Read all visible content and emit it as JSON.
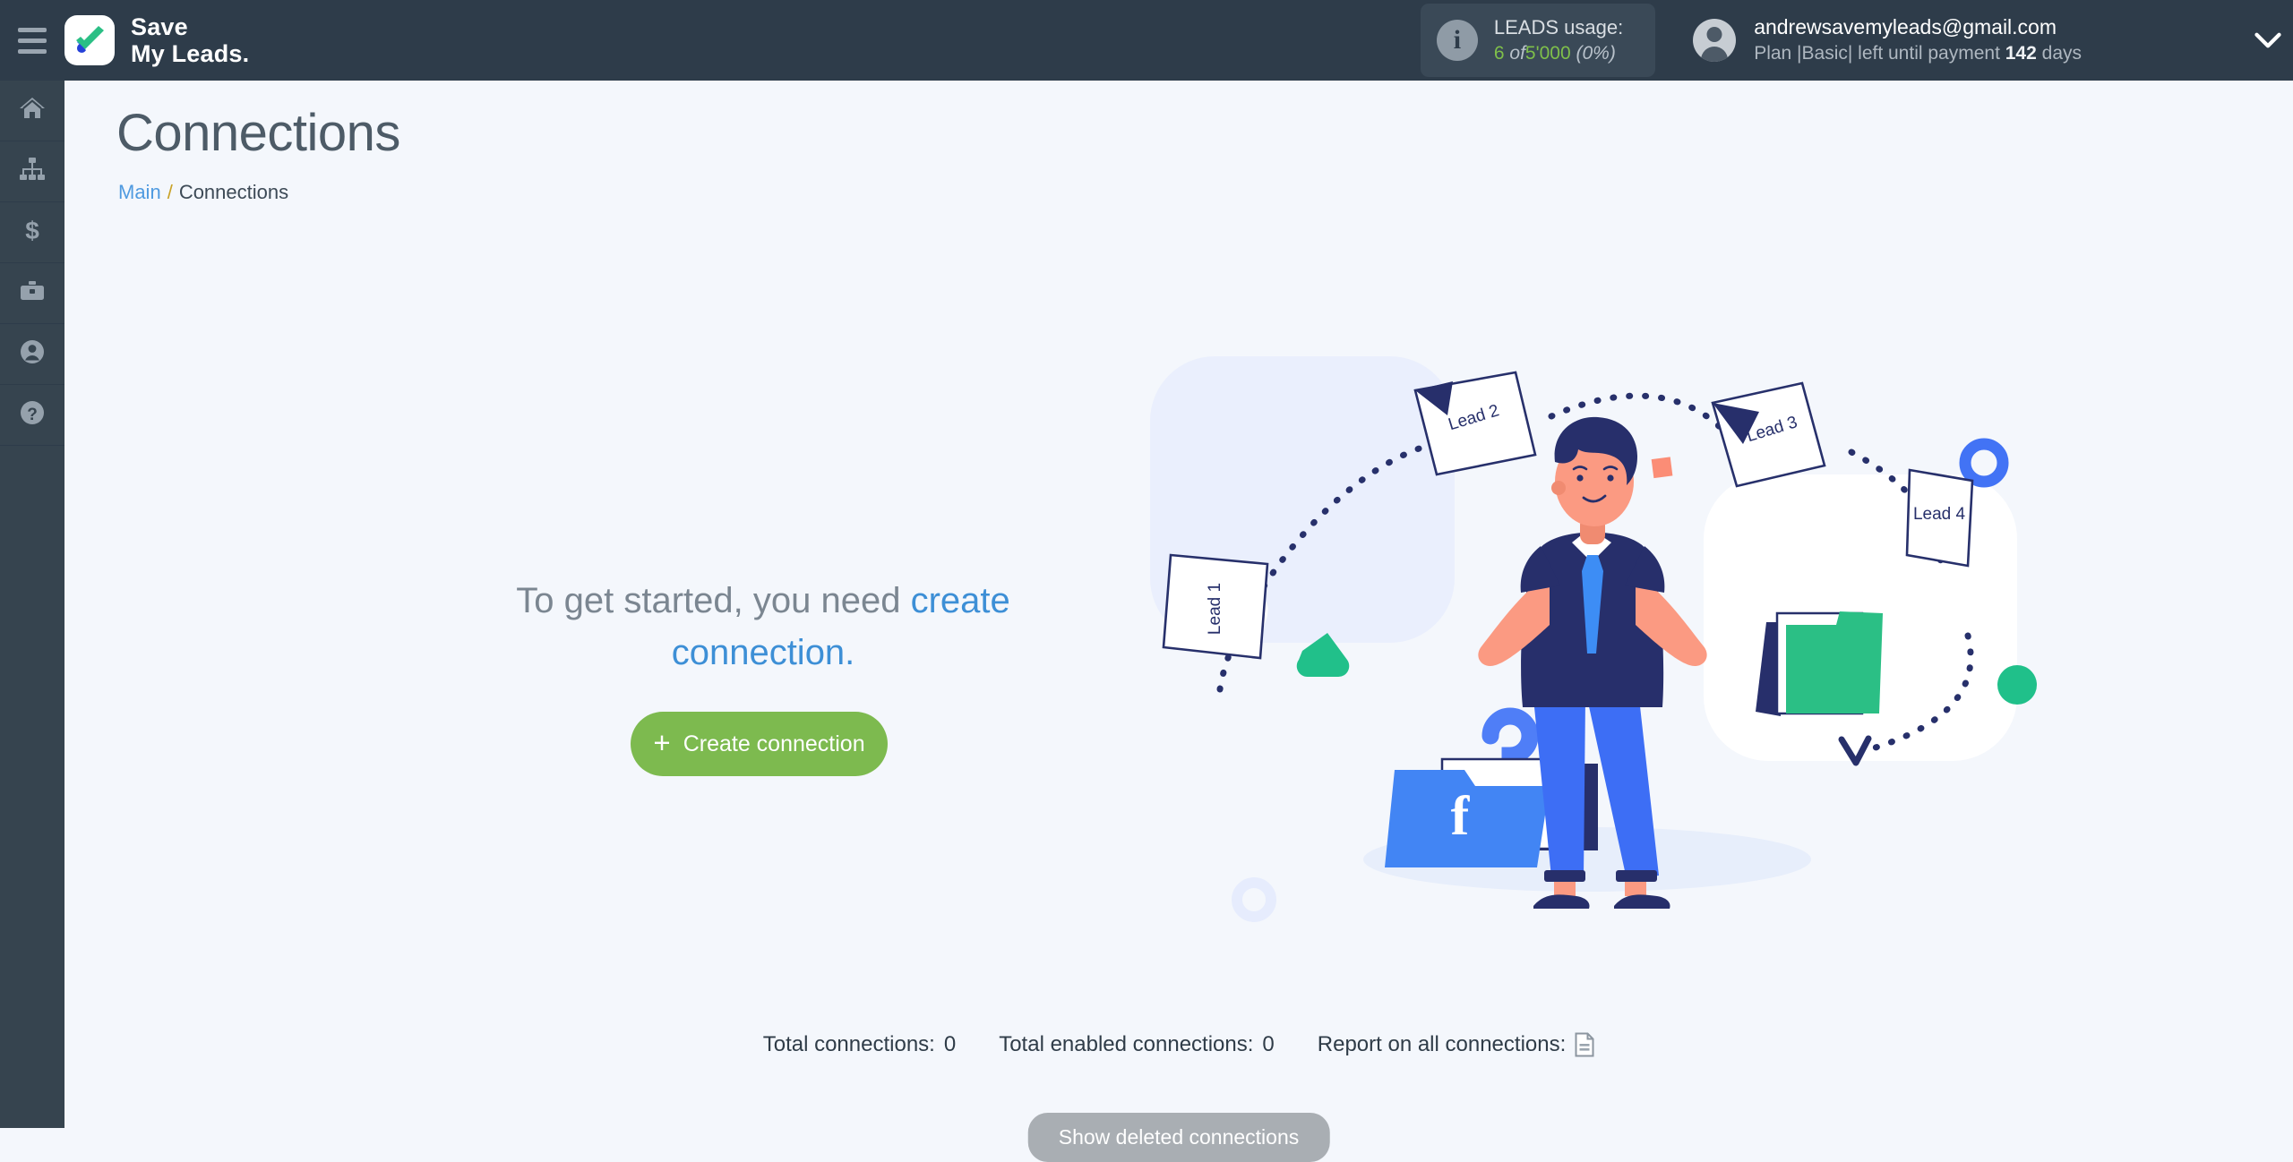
{
  "header": {
    "menu_icon": "hamburger-icon",
    "brand_line1": "Save",
    "brand_line2": "My Leads.",
    "usage": {
      "icon": "info-icon",
      "icon_glyph": "i",
      "title": "LEADS usage:",
      "used": "6",
      "of": "of",
      "total": "5'000",
      "percent": "(0%)"
    },
    "account": {
      "avatar_icon": "user-avatar-icon",
      "email": "andrewsavemyleads@gmail.com",
      "plan_prefix": "Plan |Basic| left until payment",
      "days_value": "142",
      "days_suffix": "days",
      "dropdown_icon": "chevron-down-icon"
    }
  },
  "sidebar": {
    "items": [
      {
        "name": "home",
        "icon": "home-icon",
        "label": "Main"
      },
      {
        "name": "connections",
        "icon": "sitemap-icon",
        "label": "Connections"
      },
      {
        "name": "payments",
        "icon": "dollar-icon",
        "label": "Payments"
      },
      {
        "name": "services",
        "icon": "briefcase-icon",
        "label": "Services"
      },
      {
        "name": "profile",
        "icon": "user-icon",
        "label": "Profile"
      },
      {
        "name": "help",
        "icon": "question-circle-icon",
        "label": "Help"
      }
    ]
  },
  "page": {
    "title": "Connections",
    "breadcrumb": {
      "root": "Main",
      "separator": "/",
      "current": "Connections"
    }
  },
  "empty_state": {
    "text_plain": "To get started, you need ",
    "text_link": "create connection.",
    "create_button": {
      "icon": "plus-icon",
      "plus": "+",
      "label": "Create connection"
    }
  },
  "illustration": {
    "lead_cards": [
      "Lead 1",
      "Lead 2",
      "Lead 3",
      "Lead 4"
    ],
    "source_folder_icon": "facebook-folder-icon",
    "destination_folder_icon": "green-folder-icon",
    "character": "person-shrugging-illustration"
  },
  "footer": {
    "total_connections_label": "Total connections:",
    "total_connections_value": "0",
    "total_enabled_label": "Total enabled connections:",
    "total_enabled_value": "0",
    "report_label": "Report on all connections:",
    "report_icon": "document-report-icon",
    "show_deleted_label": "Show deleted connections"
  },
  "colors": {
    "header_bg": "#2e3c4a",
    "sidebar_bg": "#36444f",
    "page_bg": "#f4f7fc",
    "panel_bg": "#eaeffd",
    "accent_green": "#7dba4f",
    "link_blue": "#3d8fd6",
    "usage_green": "#7fc04a",
    "facebook_blue": "#4285f4",
    "folder_green": "#2bbf85",
    "navy": "#27306b"
  }
}
